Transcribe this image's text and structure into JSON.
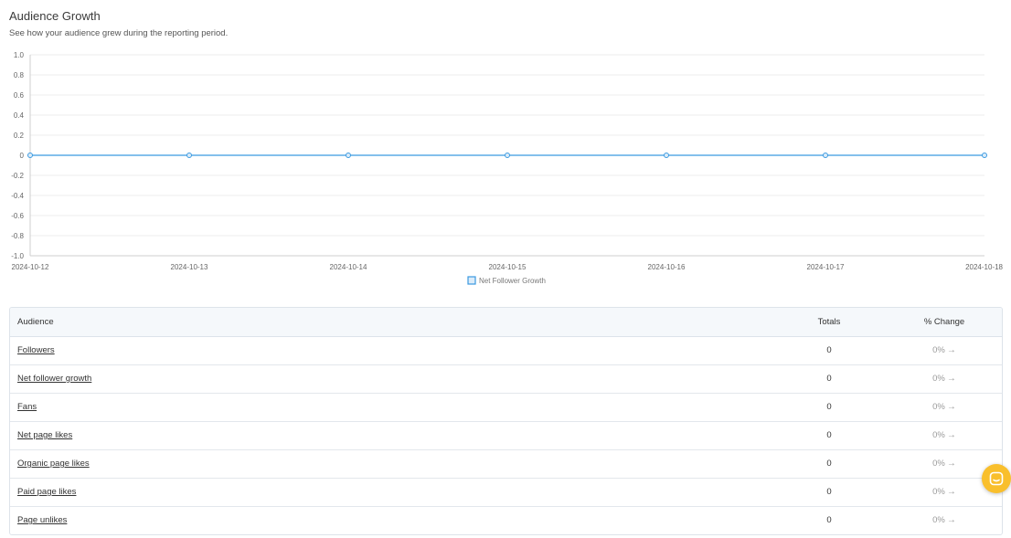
{
  "header": {
    "title": "Audience Growth",
    "subtitle": "See how your audience grew during the reporting period."
  },
  "chart_data": {
    "type": "line",
    "x": [
      "2024-10-12",
      "2024-10-13",
      "2024-10-14",
      "2024-10-15",
      "2024-10-16",
      "2024-10-17",
      "2024-10-18"
    ],
    "series": [
      {
        "name": "Net Follower Growth",
        "values": [
          0,
          0,
          0,
          0,
          0,
          0,
          0
        ],
        "color": "#3b9ae1"
      }
    ],
    "ylim": [
      -1.0,
      1.0
    ],
    "yticks": [
      "1.0",
      "0.8",
      "0.6",
      "0.4",
      "0.2",
      "0",
      "-0.2",
      "-0.4",
      "-0.6",
      "-0.8",
      "-1.0"
    ],
    "grid": true,
    "legend": "bottom-center"
  },
  "table": {
    "headers": {
      "audience": "Audience",
      "totals": "Totals",
      "change": "% Change"
    },
    "rows": [
      {
        "label": "Followers",
        "total": "0",
        "change": "0%"
      },
      {
        "label": "Net follower growth",
        "total": "0",
        "change": "0%"
      },
      {
        "label": "Fans",
        "total": "0",
        "change": "0%"
      },
      {
        "label": "Net page likes",
        "total": "0",
        "change": "0%"
      },
      {
        "label": "Organic page likes",
        "total": "0",
        "change": "0%"
      },
      {
        "label": "Paid page likes",
        "total": "0",
        "change": "0%"
      },
      {
        "label": "Page unlikes",
        "total": "0",
        "change": "0%"
      }
    ]
  },
  "icons": {
    "change_arrow": "arrow-right-icon",
    "chat": "chat-bubble-icon"
  },
  "colors": {
    "accent": "#3b9ae1",
    "chat_button": "#f9bf2c"
  }
}
